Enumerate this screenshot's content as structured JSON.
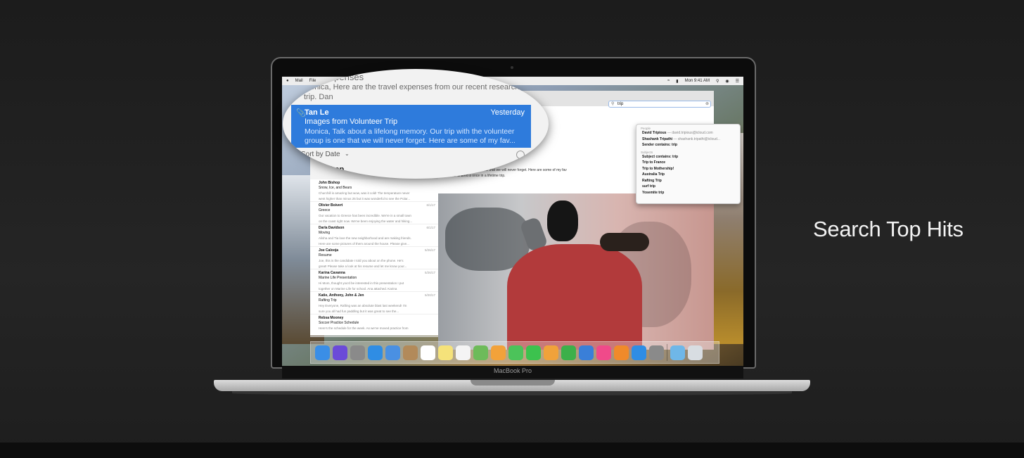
{
  "slide": {
    "title": "Search Top Hits"
  },
  "device": {
    "label": "MacBook Pro"
  },
  "menubar": {
    "apple": "",
    "app_menus": [
      "Mail",
      "File"
    ],
    "clock": "Mon 9:41 AM"
  },
  "search": {
    "query": "trip",
    "sections": [
      {
        "title": "People",
        "rows": [
          {
            "label": "David Tripious",
            "addr": "— david.tripious@icloud.com"
          },
          {
            "label": "Shashank Tripathi",
            "addr": "— shashank.tripathi@icloud..."
          },
          {
            "label": "Sender contains: trip",
            "addr": ""
          }
        ]
      },
      {
        "title": "Subjects",
        "rows": [
          {
            "label": "Subject contains: trip",
            "addr": ""
          },
          {
            "label": "Trip to France",
            "addr": ""
          },
          {
            "label": "Trip to Mothership!",
            "addr": ""
          },
          {
            "label": "Australia Trip",
            "addr": ""
          },
          {
            "label": "Rafting Trip",
            "addr": ""
          },
          {
            "label": "surf trip",
            "addr": ""
          },
          {
            "label": "Yosemite trip",
            "addr": ""
          }
        ]
      }
    ]
  },
  "magnifier": {
    "prev_subject": "Expenses",
    "prev_preview": [
      "Monica, Here are the travel expenses from our recent research",
      "trip. Dan"
    ],
    "selected": {
      "from": "Tan Le",
      "date": "Yesterday",
      "subject": "Images from Volunteer Trip",
      "preview": [
        "Monica, Talk about a lifelong memory. Our trip with the volunteer",
        "group is one that we will never forget.  Here are some of my fav..."
      ]
    },
    "sort_label": "Sort by Date",
    "next_from": "Bishop"
  },
  "messages": [
    {
      "from": "John Bishop",
      "date": "",
      "subject": "Snow, Ice, and Bears",
      "preview": [
        "Churchill is amazing but wow, was it cold! The temperature never",
        "went higher than minus 25 but it was wonderful to see the Polar..."
      ]
    },
    {
      "from": "Olivier Boivert",
      "date": "6/1/17",
      "subject": "Greece",
      "preview": [
        "Our vacation to Greece has been incredible. We're in a small town",
        "on the coast right now. We've been enjoying the water and hiking..."
      ]
    },
    {
      "from": "Darla Davidson",
      "date": "6/1/17",
      "subject": "Moving",
      "preview": [
        "Alisha and Tia love the new neighborhood and are making friends.",
        "Here are some pictures of them around the house. Please give..."
      ]
    },
    {
      "from": "Joe Calooja",
      "date": "5/26/17",
      "subject": "Resume",
      "preview": [
        "Joe, this is the candidate I told you about on the phone. He's",
        "great! Please take a look at his resume and let me know your..."
      ]
    },
    {
      "from": "Karina Cavanna",
      "date": "5/26/17",
      "subject": "Marine Life Presentation",
      "preview": [
        "Hi Mom, thought you'd be interested in this presentation I put",
        "together on Marine Life for school. Ana attached. Karina"
      ]
    },
    {
      "from": "Katie, Anthony, John & Jen",
      "date": "5/20/17",
      "subject": "Rafting Trip",
      "preview": [
        "Hey Everyone, Rafting was an absolute blast last weekend! I'm",
        "sure you all had fun paddling but it was great to see the..."
      ]
    },
    {
      "from": "Rebsa Mooney",
      "date": "",
      "subject": "Soccer Practice Schedule",
      "preview": [
        "Here's the schedule for the week. As we've moved practice from",
        ""
      ]
    }
  ],
  "email_body": {
    "lines": [
      "... the volunteer group is one that we will never forget. Here are some of my fav",
      "... never shared a once in a lifetime trip."
    ]
  },
  "dock": {
    "icons": [
      {
        "name": "finder-icon",
        "color": "#3a8ee6"
      },
      {
        "name": "siri-icon",
        "color": "#6b4bd8"
      },
      {
        "name": "launchpad-icon",
        "color": "#8a8a8a"
      },
      {
        "name": "safari-icon",
        "color": "#2f8de4"
      },
      {
        "name": "mail-icon",
        "color": "#4a90e2"
      },
      {
        "name": "contacts-icon",
        "color": "#b28a5a"
      },
      {
        "name": "calendar-icon",
        "color": "#ffffff"
      },
      {
        "name": "notes-icon",
        "color": "#f5e27a"
      },
      {
        "name": "reminders-icon",
        "color": "#f4f4f4"
      },
      {
        "name": "maps-icon",
        "color": "#6dbb5a"
      },
      {
        "name": "photos-icon",
        "color": "#f2a23a"
      },
      {
        "name": "messages-icon",
        "color": "#4cc35a"
      },
      {
        "name": "facetime-icon",
        "color": "#3cc24e"
      },
      {
        "name": "pages-icon",
        "color": "#f0a23a"
      },
      {
        "name": "numbers-icon",
        "color": "#3cb04a"
      },
      {
        "name": "keynote-icon",
        "color": "#3a7fd8"
      },
      {
        "name": "music-icon",
        "color": "#f04a8a"
      },
      {
        "name": "books-icon",
        "color": "#f08a2a"
      },
      {
        "name": "app-store-icon",
        "color": "#2f8de4"
      },
      {
        "name": "system-preferences-icon",
        "color": "#8a8a8a"
      }
    ],
    "trailing": [
      {
        "name": "downloads-folder-icon",
        "color": "#6fb7e8"
      },
      {
        "name": "trash-icon",
        "color": "#d8dde2"
      }
    ]
  }
}
